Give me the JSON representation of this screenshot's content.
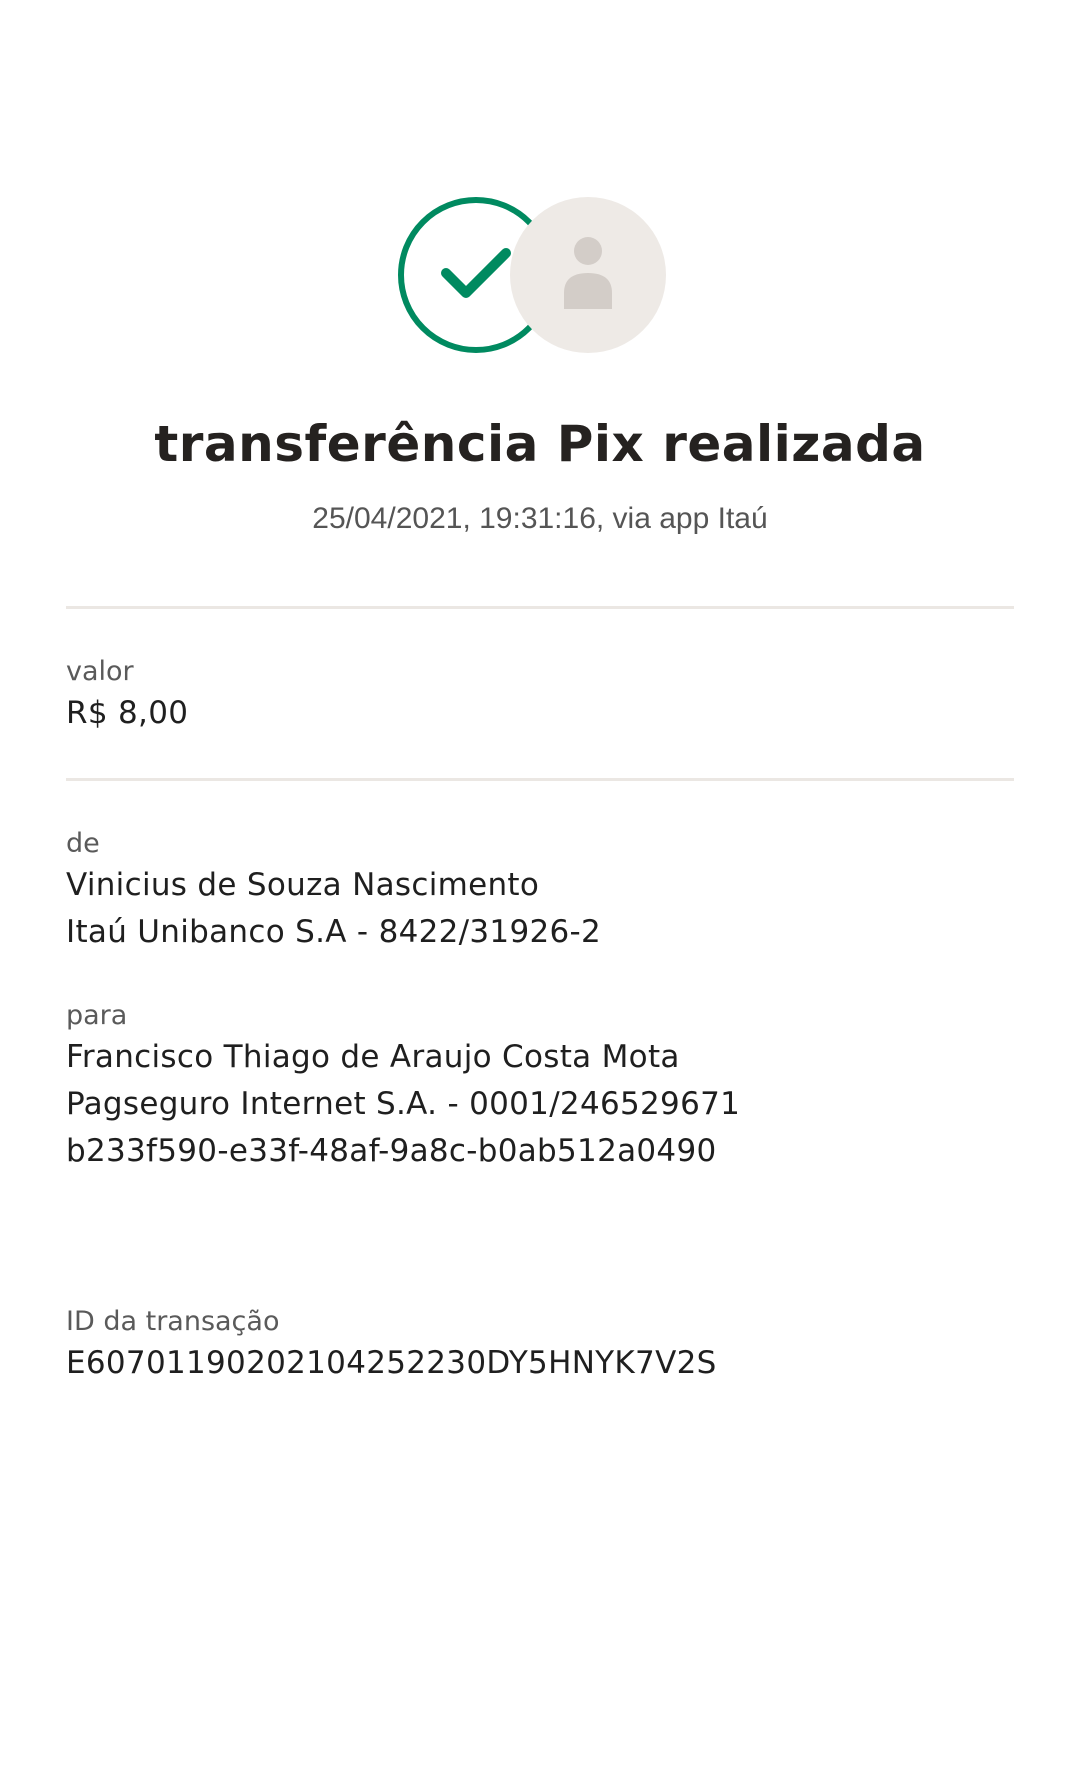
{
  "status": {
    "title": "transferência Pix realizada",
    "subtitle": "25/04/2021,  19:31:16, via app Itaú",
    "success_icon": "check-circle-icon",
    "avatar_icon": "person-icon",
    "colors": {
      "success": "#008a60",
      "avatar_bg": "#eeeae6",
      "avatar_fg": "#d3cdc8"
    }
  },
  "valor": {
    "label": "valor",
    "amount": "R$ 8,00"
  },
  "de": {
    "label": "de",
    "name": "Vinicius de Souza Nascimento",
    "bank": "Itaú Unibanco S.A - 8422/31926-2"
  },
  "para": {
    "label": "para",
    "name": "Francisco Thiago de Araujo Costa Mota",
    "bank": "Pagseguro Internet S.A. - 0001/246529671",
    "key": "b233f590-e33f-48af-9a8c-b0ab512a0490"
  },
  "transacao": {
    "label": "ID da transação",
    "id": "E60701190202104252230DY5HNYK7V2S"
  }
}
